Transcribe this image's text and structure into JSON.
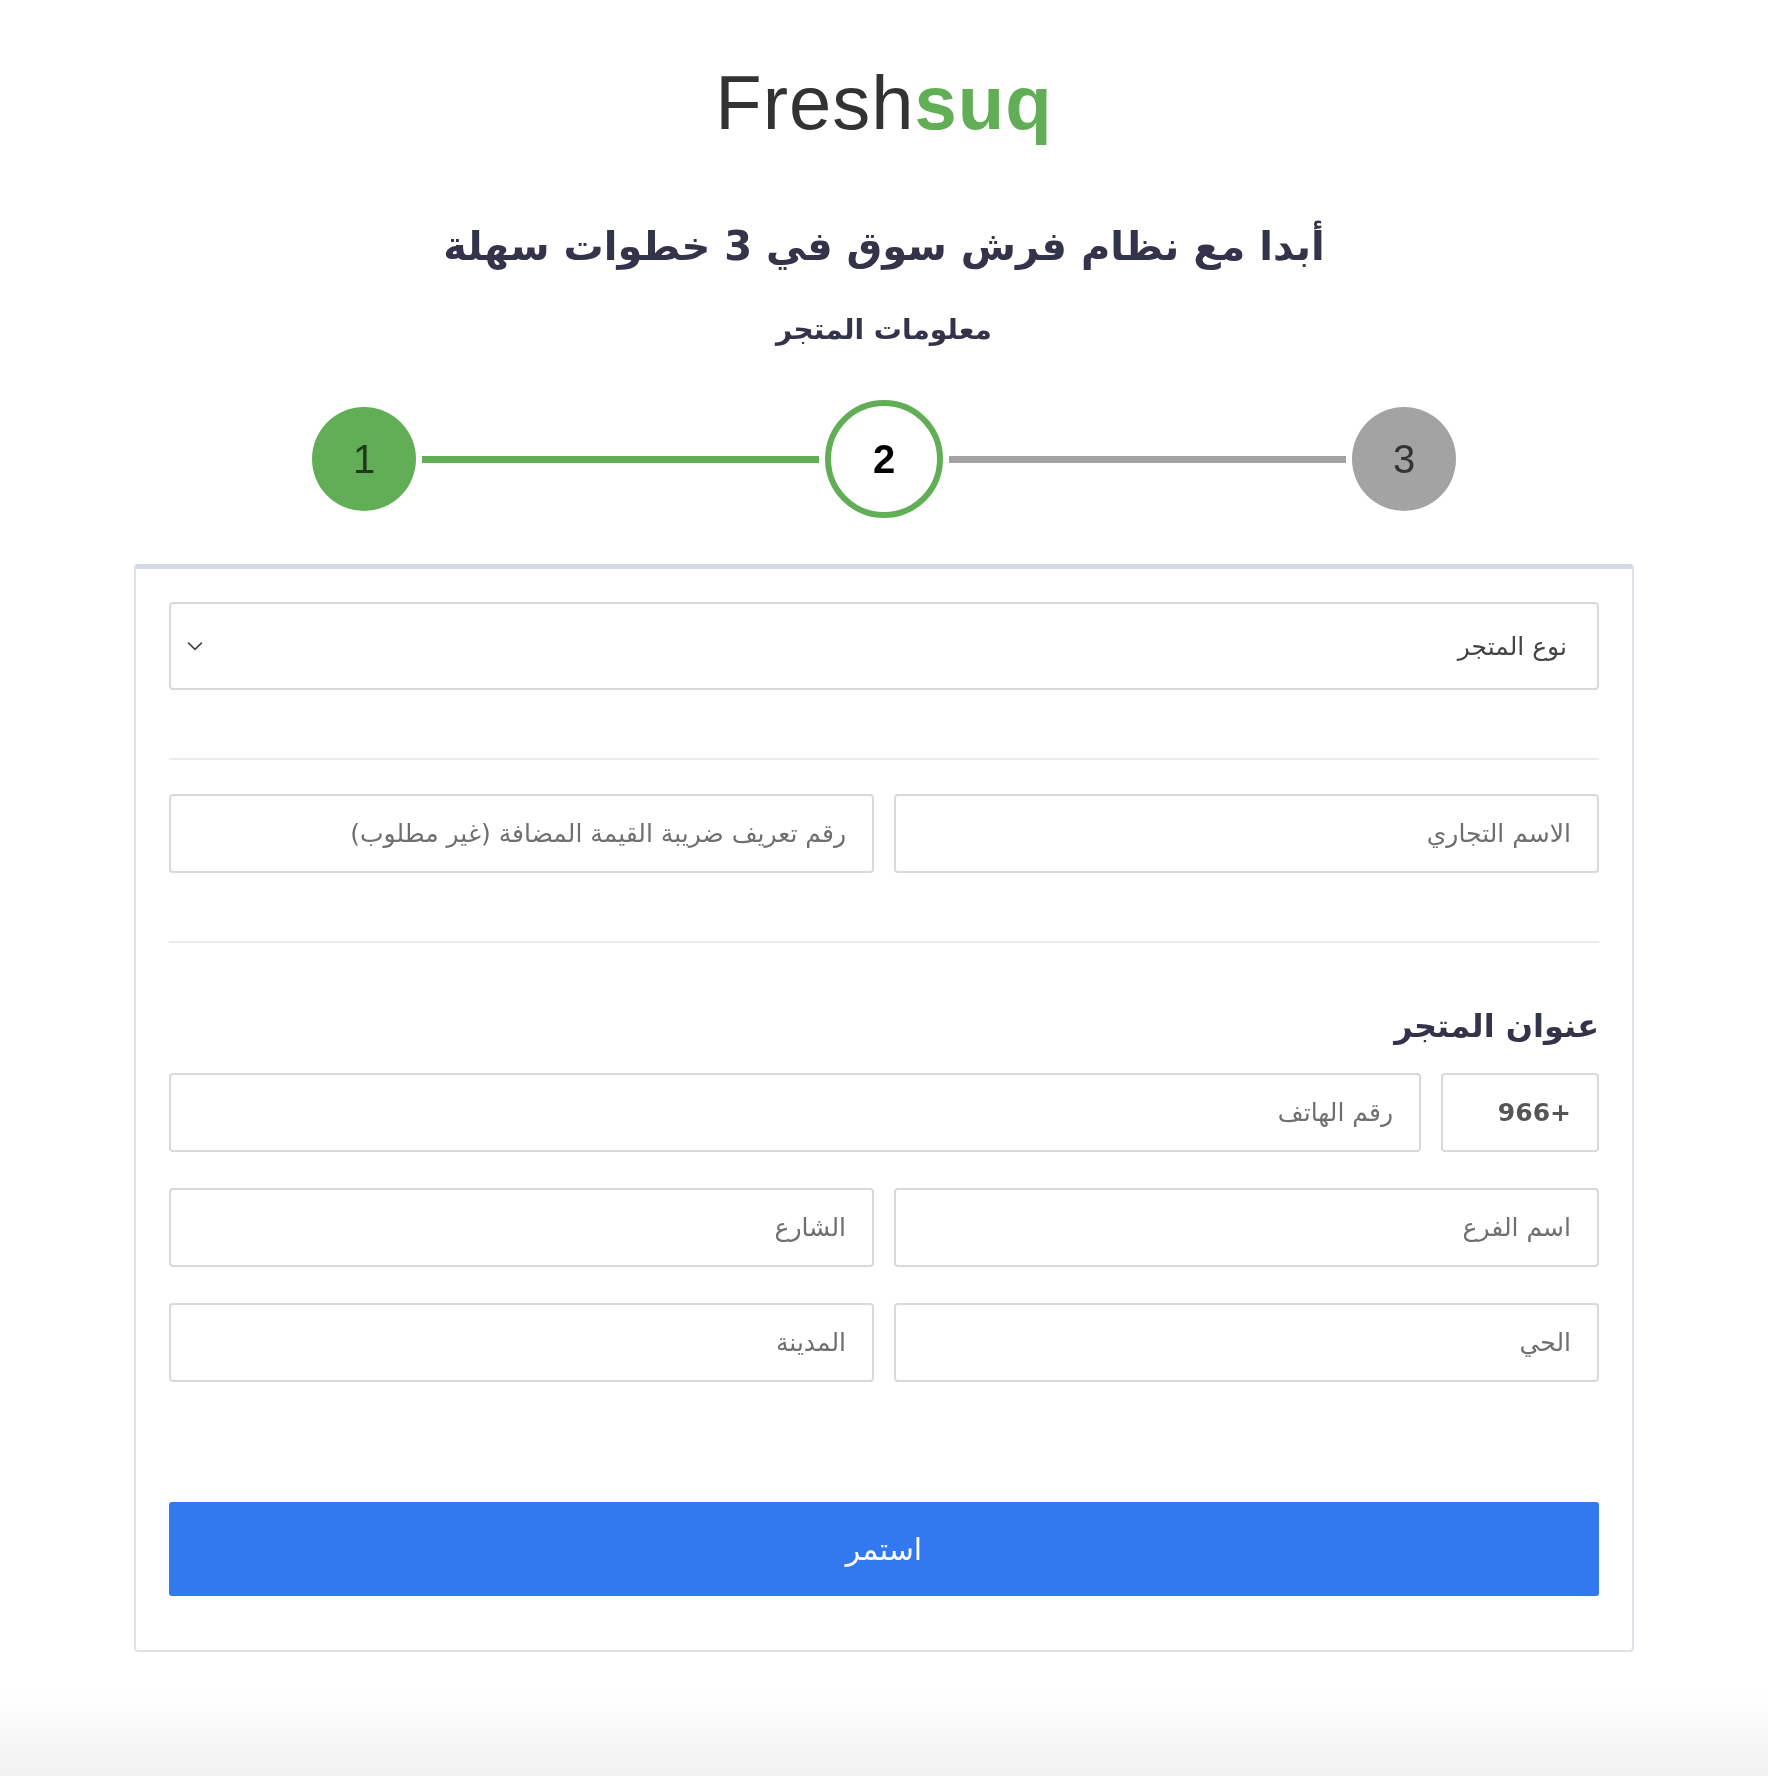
{
  "logo": {
    "text": "Fresh",
    "accent_text": "suq"
  },
  "title": "أبدا مع نظام فرش سوق في 3 خطوات سهلة",
  "subtitle": "معلومات المتجر",
  "steps": [
    {
      "label": "3",
      "completed": false,
      "selected": false
    },
    {
      "label": "2",
      "completed": false,
      "selected": true
    },
    {
      "label": "1",
      "completed": true,
      "selected": false
    }
  ],
  "form": {
    "store_type": {
      "placeholder": "نوع المتجر"
    },
    "business_fields": [
      {
        "placeholder": "الاسم التجاري"
      },
      {
        "placeholder": "رقم تعريف ضريبة القيمة المضافة (غير مطلوب)"
      }
    ],
    "address_heading": "عنوان المتجر",
    "phone": {
      "prefix": "+966",
      "placeholder": "رقم الهاتف"
    },
    "address_fields": [
      {
        "placeholder": "اسم الفرع"
      },
      {
        "placeholder": "الشارع"
      },
      {
        "placeholder": "الحي"
      },
      {
        "placeholder": "المدينة"
      }
    ],
    "submit": "استمر"
  }
}
